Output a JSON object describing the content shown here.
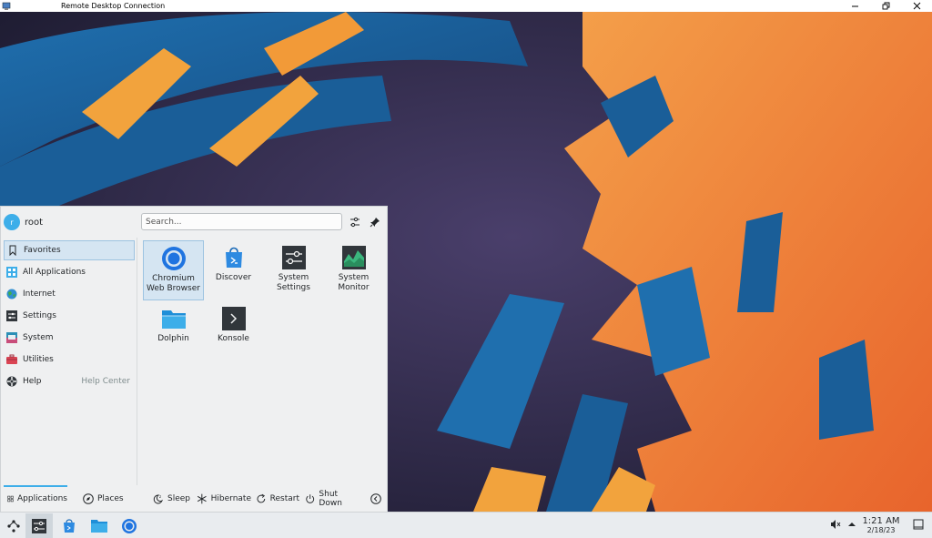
{
  "window": {
    "title": "Remote Desktop Connection",
    "controls": [
      "minimize",
      "restore",
      "close"
    ]
  },
  "launcher": {
    "user": {
      "name": "root",
      "initial": "r"
    },
    "search": {
      "placeholder": "Search..."
    },
    "header_icons": [
      "configure-icon",
      "pin-icon"
    ],
    "sidebar": [
      {
        "label": "Favorites",
        "icon": "bookmark-icon",
        "active": true,
        "extra": ""
      },
      {
        "label": "All Applications",
        "icon": "all-apps-icon",
        "active": false,
        "extra": ""
      },
      {
        "label": "Internet",
        "icon": "globe-icon",
        "active": false,
        "extra": ""
      },
      {
        "label": "Settings",
        "icon": "settings-icon",
        "active": false,
        "extra": ""
      },
      {
        "label": "System",
        "icon": "system-icon",
        "active": false,
        "extra": ""
      },
      {
        "label": "Utilities",
        "icon": "toolbox-icon",
        "active": false,
        "extra": ""
      },
      {
        "label": "Help",
        "icon": "help-icon",
        "active": false,
        "extra": "Help Center"
      }
    ],
    "favorites": [
      {
        "label": "Chromium Web Browser",
        "icon": "chromium-icon",
        "active": true
      },
      {
        "label": "Discover",
        "icon": "discover-icon",
        "active": false
      },
      {
        "label": "System Settings",
        "icon": "system-settings-icon",
        "active": false
      },
      {
        "label": "System Monitor",
        "icon": "system-monitor-icon",
        "active": false
      },
      {
        "label": "Dolphin",
        "icon": "folder-icon",
        "active": false
      },
      {
        "label": "Konsole",
        "icon": "terminal-icon",
        "active": false
      }
    ],
    "footer": {
      "applications": "Applications",
      "places": "Places",
      "sleep": "Sleep",
      "hibernate": "Hibernate",
      "restart": "Restart",
      "shutdown": "Shut Down"
    }
  },
  "taskbar": {
    "items": [
      "launcher-icon",
      "system-settings-icon",
      "discover-icon",
      "folder-icon",
      "chromium-icon"
    ],
    "tray": [
      "volume-muted-icon",
      "tray-expand-icon"
    ],
    "clock": {
      "time": "1:21 AM",
      "date": "2/18/23"
    }
  },
  "colors": {
    "accent": "#3daee9",
    "panel": "#eff0f1",
    "selection": "#d5e5f2",
    "wallpaper_orange": "#f0803c",
    "wallpaper_blue": "#1c6aa8"
  }
}
